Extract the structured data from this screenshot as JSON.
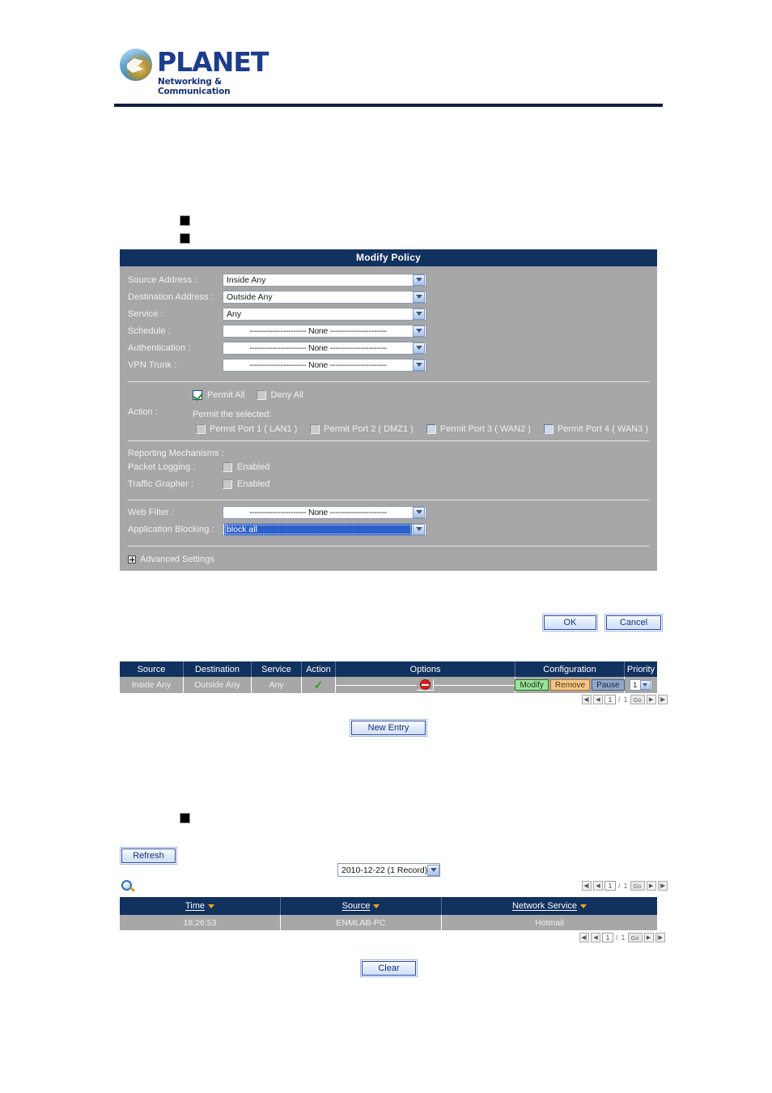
{
  "brand": {
    "name": "PLANET",
    "tagline": "Networking & Communication"
  },
  "policy_panel": {
    "title": "Modify Policy",
    "fields": [
      {
        "label": "Source Address :",
        "value": "Inside Any",
        "centered": false
      },
      {
        "label": "Destination Address :",
        "value": "Outside Any",
        "centered": false
      },
      {
        "label": "Service :",
        "value": "Any",
        "centered": false
      },
      {
        "label": "Schedule :",
        "value": "---------------------- None ----------------------",
        "centered": true
      },
      {
        "label": "Authentication :",
        "value": "---------------------- None ----------------------",
        "centered": true
      },
      {
        "label": "VPN Trunk :",
        "value": "---------------------- None ----------------------",
        "centered": true
      }
    ],
    "action": {
      "label": "Action :",
      "permit_all": "Permit All",
      "deny_all": "Deny All",
      "permit_selected": "Permit the selected:",
      "ports": [
        "Permit Port  1  ( LAN1 )",
        "Permit Port  2  ( DMZ1 )",
        "Permit Port  3  ( WAN2 )",
        "Permit Port  4  ( WAN3 )"
      ]
    },
    "reporting": {
      "title": "Reporting Mechanisms :",
      "packet_logging_label": "Packet Logging :",
      "packet_logging_value": "Enabled",
      "traffic_grapher_label": "Traffic Grapher :",
      "traffic_grapher_value": "Enabled"
    },
    "web_filter": {
      "label": "Web Filter :",
      "value": "---------------------- None ----------------------"
    },
    "app_blocking": {
      "label": "Application Blocking :",
      "value": "block all"
    },
    "advanced_settings": "Advanced Settings",
    "ok_label": "OK",
    "cancel_label": "Cancel"
  },
  "policy_table": {
    "headers": {
      "source": "Source",
      "destination": "Destination",
      "service": "Service",
      "action": "Action",
      "options": "Options",
      "configuration": "Configuration",
      "priority": "Priority"
    },
    "row": {
      "source": "Inside Any",
      "destination": "Outside Any",
      "service": "Any",
      "modify": "Modify",
      "remove": "Remove",
      "pause": "Pause",
      "priority": "1"
    },
    "new_entry_label": "New Entry"
  },
  "pager": {
    "current": "1",
    "separator": "/",
    "total": "1",
    "go": "Go"
  },
  "log_section": {
    "refresh_label": "Refresh",
    "date_filter": "2010-12-22 (1 Record)",
    "headers": {
      "time": "Time",
      "source": "Source",
      "network_service": "Network Service"
    },
    "rows": [
      {
        "time": "18:26:53",
        "source": "ENMLAB-PC",
        "network_service": "Hotmail"
      }
    ],
    "clear_label": "Clear"
  },
  "colors": {
    "header_navy": "#11315f",
    "panel_gray": "#a7a7a7",
    "accent_green": "#27a327",
    "accent_red": "#d91f1f",
    "sort_orange": "#f0a90e",
    "select_blue": "#2b5fc9"
  }
}
